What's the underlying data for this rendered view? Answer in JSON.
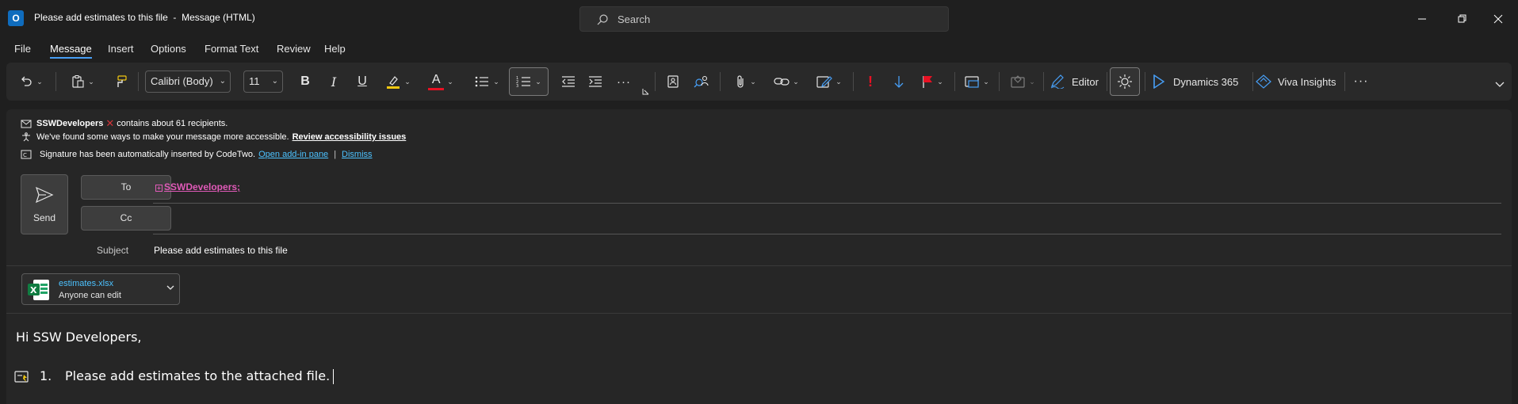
{
  "window": {
    "title": "Please add estimates to this file  -  Message (HTML)",
    "search_placeholder": "Search",
    "app_icon_letter": "O"
  },
  "menu": {
    "items": [
      "File",
      "Message",
      "Insert",
      "Options",
      "Format Text",
      "Review",
      "Help"
    ],
    "active": "Message"
  },
  "ribbon": {
    "font_name": "Calibri (Body)",
    "font_size": "11",
    "bold": "B",
    "italic": "I",
    "underline": "U",
    "font_color_letter": "A",
    "important_mark": "!",
    "editor_label": "Editor",
    "dynamics_label": "Dynamics 365",
    "viva_label": "Viva Insights",
    "more": "···",
    "colors": {
      "highlight": "#f2c811",
      "font_color": "#e81123",
      "flag": "#e81123",
      "important": "#e81123",
      "dynamics": "#479ef5"
    }
  },
  "infobar": {
    "recipients_group": "SSWDevelopers",
    "recipients_text": "contains about 61 recipients.",
    "accessibility_text": "We've found some ways to make your message more accessible.",
    "accessibility_link": "Review accessibility issues",
    "signature_text": "Signature has been automatically inserted by CodeTwo.",
    "open_addin_link": "Open add-in pane",
    "separator": "|",
    "dismiss_link": "Dismiss"
  },
  "compose": {
    "send_label": "Send",
    "to_label": "To",
    "cc_label": "Cc",
    "to_value": "SSWDevelopers",
    "to_suffix": ";",
    "subject_label": "Subject",
    "subject_value": "Please add estimates to this file"
  },
  "attachment": {
    "filename": "estimates.xlsx",
    "permission": "Anyone can edit"
  },
  "body": {
    "greeting": "Hi SSW Developers,",
    "list_number": "1.",
    "list_item": "Please add estimates to the attached file."
  }
}
